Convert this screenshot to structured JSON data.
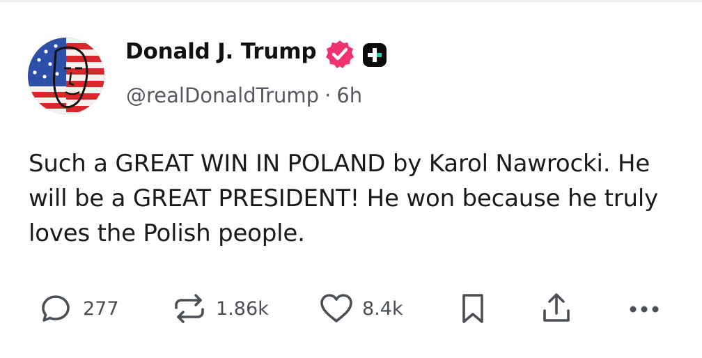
{
  "author": {
    "display_name": "Donald J. Trump",
    "handle": "@realDonaldTrump",
    "separator": "·",
    "time_ago": "6h",
    "verified": true,
    "verified_color": "#f0336e"
  },
  "post": {
    "text": "Such a GREAT WIN IN POLAND by Karol Nawrocki. He will be a GREAT PRESIDENT! He won because he truly loves the Polish people."
  },
  "actions": {
    "replies": "277",
    "reposts": "1.86k",
    "likes": "8.4k"
  },
  "icons": {
    "reply": "reply-bubble-icon",
    "repost": "repost-arrows-icon",
    "like": "heart-icon",
    "bookmark": "bookmark-icon",
    "share": "share-upload-icon",
    "more": "more-dots-icon",
    "verified": "verified-badge-icon",
    "platform": "platform-plus-icon"
  },
  "colors": {
    "text": "#111111",
    "secondary_text": "#555a60",
    "icon_gray": "#4a4f55",
    "verified_pink": "#f0336e"
  }
}
